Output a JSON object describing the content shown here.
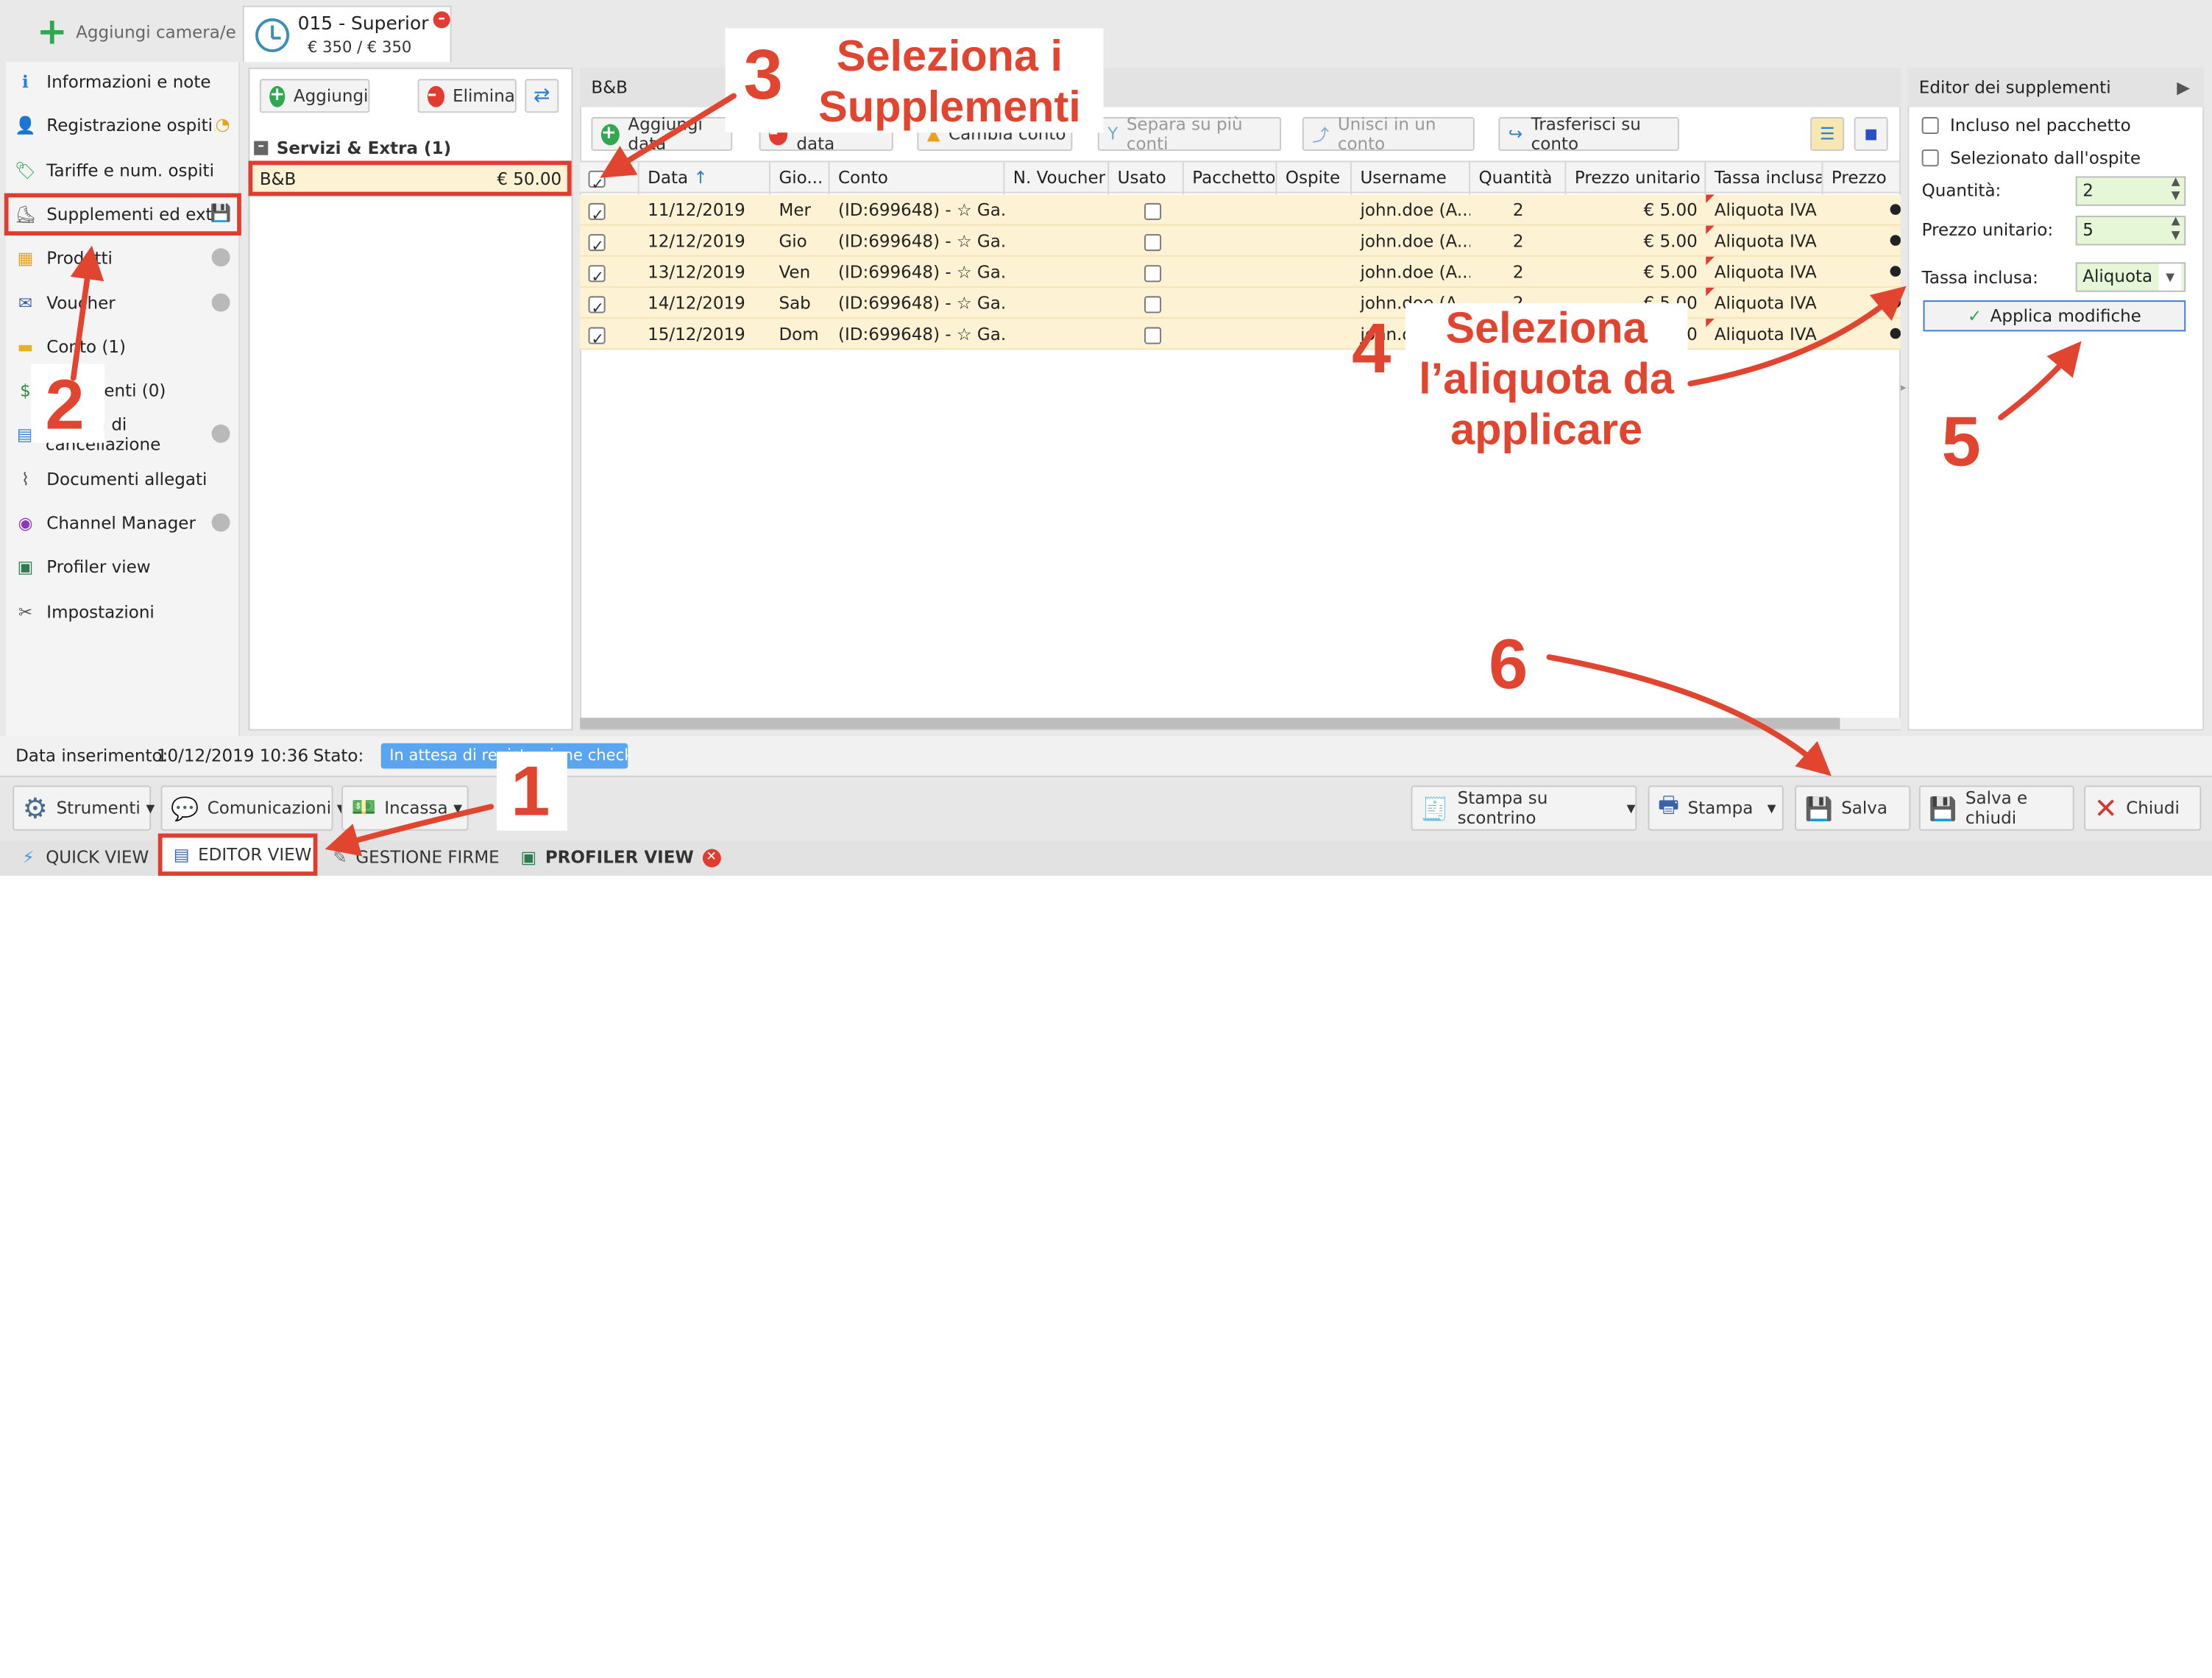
{
  "add_room": "Aggiungi camera/e",
  "room_tab": {
    "title": "015 - Superior",
    "price": "€ 350 / € 350"
  },
  "sidebar": [
    {
      "label": "Informazioni e note"
    },
    {
      "label": "Registrazione ospiti"
    },
    {
      "label": "Tariffe e num. ospiti"
    },
    {
      "label": "Supplementi ed extra"
    },
    {
      "label": "Prodotti"
    },
    {
      "label": "Voucher"
    },
    {
      "label": "Conto (1)"
    },
    {
      "label": "Pagamenti (0)"
    },
    {
      "label": "Politica di cancellazione"
    },
    {
      "label": "Documenti allegati"
    },
    {
      "label": "Channel Manager"
    },
    {
      "label": "Profiler view"
    },
    {
      "label": "Impostazioni"
    }
  ],
  "left_panel": {
    "add": "Aggiungi",
    "delete": "Elimina",
    "group": "Servizi & Extra (1)",
    "item_name": "B&B",
    "item_price": "€ 50.00"
  },
  "grid": {
    "title": "B&B",
    "toolbar": {
      "add_date": "Aggiungi data",
      "delete_date": "Elimina data",
      "change_account": "Cambia conto",
      "split": "Separa su più conti",
      "merge": "Unisci in un conto",
      "transfer": "Trasferisci su conto"
    },
    "columns": [
      "Data",
      "Gio...",
      "Conto",
      "N. Voucher",
      "Usato",
      "Pacchetto",
      "Ospite",
      "Username",
      "Quantità",
      "Prezzo unitario",
      "Tassa inclusa",
      "Prezzo"
    ],
    "rows": [
      {
        "date": "11/12/2019",
        "day": "Mer",
        "account": "(ID:699648) - ☆ Ga...",
        "user": "john.doe (A...",
        "qty": "2",
        "unit": "€ 5.00",
        "tax": "Aliquota IVA"
      },
      {
        "date": "12/12/2019",
        "day": "Gio",
        "account": "(ID:699648) - ☆ Ga...",
        "user": "john.doe (A...",
        "qty": "2",
        "unit": "€ 5.00",
        "tax": "Aliquota IVA"
      },
      {
        "date": "13/12/2019",
        "day": "Ven",
        "account": "(ID:699648) - ☆ Ga...",
        "user": "john.doe (A...",
        "qty": "2",
        "unit": "€ 5.00",
        "tax": "Aliquota IVA"
      },
      {
        "date": "14/12/2019",
        "day": "Sab",
        "account": "(ID:699648) - ☆ Ga...",
        "user": "john.doe (A...",
        "qty": "2",
        "unit": "€ 5.00",
        "tax": "Aliquota IVA"
      },
      {
        "date": "15/12/2019",
        "day": "Dom",
        "account": "(ID:699648) - ☆ Ga...",
        "user": "john.doe (A...",
        "qty": "2",
        "unit": "€ 5.00",
        "tax": "Aliquota IVA"
      }
    ]
  },
  "editor": {
    "title": "Editor dei supplementi",
    "included": "Incluso nel pacchetto",
    "selected_by_guest": "Selezionato dall'ospite",
    "qty_label": "Quantità:",
    "qty_value": "2",
    "price_label": "Prezzo unitario:",
    "price_value": "5",
    "tax_label": "Tassa inclusa:",
    "tax_value": "Aliquota IVA",
    "apply": "Applica modifiche"
  },
  "status": {
    "insert_label": "Data inserimento:",
    "insert_value": "10/12/2019 10:36",
    "state_label": "Stato:",
    "state_value": "In attesa di registrazione check-in"
  },
  "actions": {
    "tools": "Strumenti",
    "comms": "Comunicazioni",
    "collect": "Incassa",
    "print_receipt": "Stampa su scontrino",
    "print": "Stampa",
    "save": "Salva",
    "save_close": "Salva e chiudi",
    "close": "Chiudi"
  },
  "tabs": {
    "quick": "QUICK VIEW",
    "editor": "EDITOR VIEW",
    "signatures": "GESTIONE FIRME",
    "profiler": "PROFILER VIEW"
  },
  "annotations": {
    "n1": "1",
    "n2": "2",
    "n3": "3",
    "n4": "4",
    "n5": "5",
    "n6": "6",
    "t3": "Seleziona i\nSupplementi",
    "t4": "Seleziona\nl’aliquota da\napplicare"
  },
  "colors": {
    "row_bg": "#fdf2d3",
    "accent_red": "#e23b2f",
    "state_blue": "#5aa5f0"
  }
}
